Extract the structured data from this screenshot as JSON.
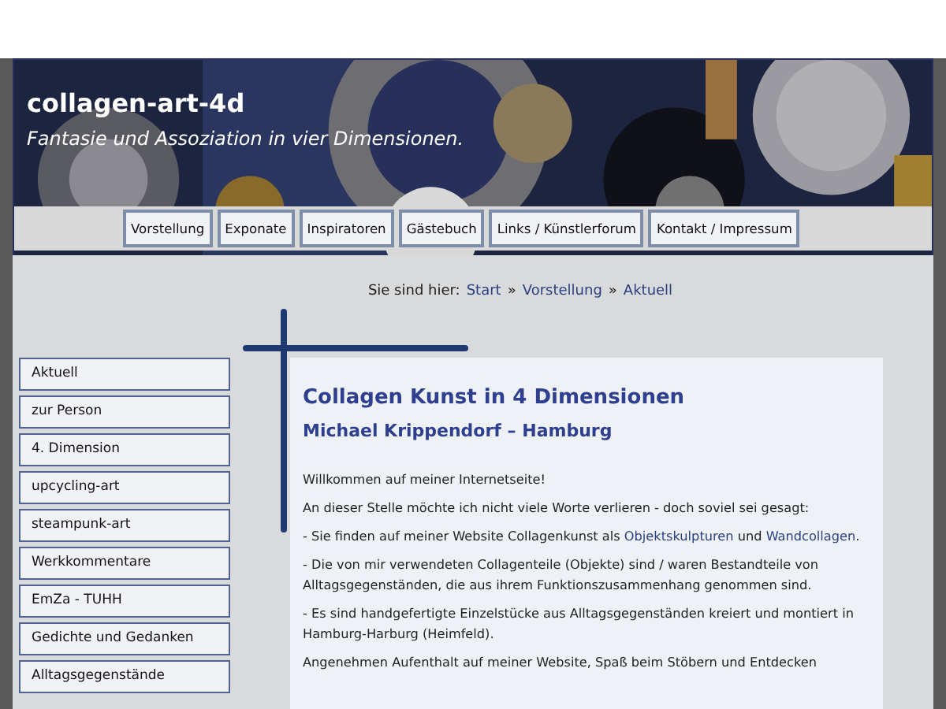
{
  "header": {
    "title": "collagen-art-4d",
    "subtitle": "Fantasie und Assoziation in vier Dimensionen."
  },
  "nav": [
    {
      "label": "Vorstellung"
    },
    {
      "label": "Exponate"
    },
    {
      "label": "Inspiratoren"
    },
    {
      "label": "Gästebuch"
    },
    {
      "label": "Links / Künstlerforum"
    },
    {
      "label": "Kontakt / Impressum"
    }
  ],
  "breadcrumb": {
    "prefix": "Sie sind hier:",
    "separator": "»",
    "items": [
      "Start",
      "Vorstellung",
      "Aktuell"
    ]
  },
  "sidebar": {
    "items": [
      {
        "label": "Aktuell"
      },
      {
        "label": "zur Person"
      },
      {
        "label": "4. Dimension"
      },
      {
        "label": "upcycling-art"
      },
      {
        "label": "steampunk-art"
      },
      {
        "label": "Werkkommentare"
      },
      {
        "label": "EmZa - TUHH"
      },
      {
        "label": "Gedichte und Gedanken"
      },
      {
        "label": "Alltagsgegenstände"
      }
    ]
  },
  "content": {
    "heading": "Collagen Kunst in 4 Dimensionen",
    "subheading": "Michael Krippendorf – Hamburg",
    "paragraphs": [
      [
        {
          "text": "Willkommen auf meiner Internetseite!"
        }
      ],
      [
        {
          "text": "An dieser Stelle möchte ich nicht viele Worte verlieren - doch soviel sei gesagt:"
        }
      ],
      [
        {
          "text": "- Sie finden auf meiner Website Collagenkunst als "
        },
        {
          "text": "Objektskulpturen",
          "link": true
        },
        {
          "text": " und "
        },
        {
          "text": "Wandcollagen",
          "link": true
        },
        {
          "text": "."
        }
      ],
      [
        {
          "text": "- Die von mir verwendeten Collagenteile (Objekte) sind / waren Bestandteile von Alltagsgegenständen, die aus ihrem Funktionszusammenhang genommen sind."
        }
      ],
      [
        {
          "text": "- Es sind handgefertigte Einzelstücke aus Alltagsgegenständen kreiert und montiert in Hamburg-Harburg (Heimfeld)."
        }
      ],
      [
        {
          "text": "Angenehmen Aufenthalt auf meiner Website, Spaß beim Stöbern und Entdecken"
        }
      ]
    ]
  }
}
